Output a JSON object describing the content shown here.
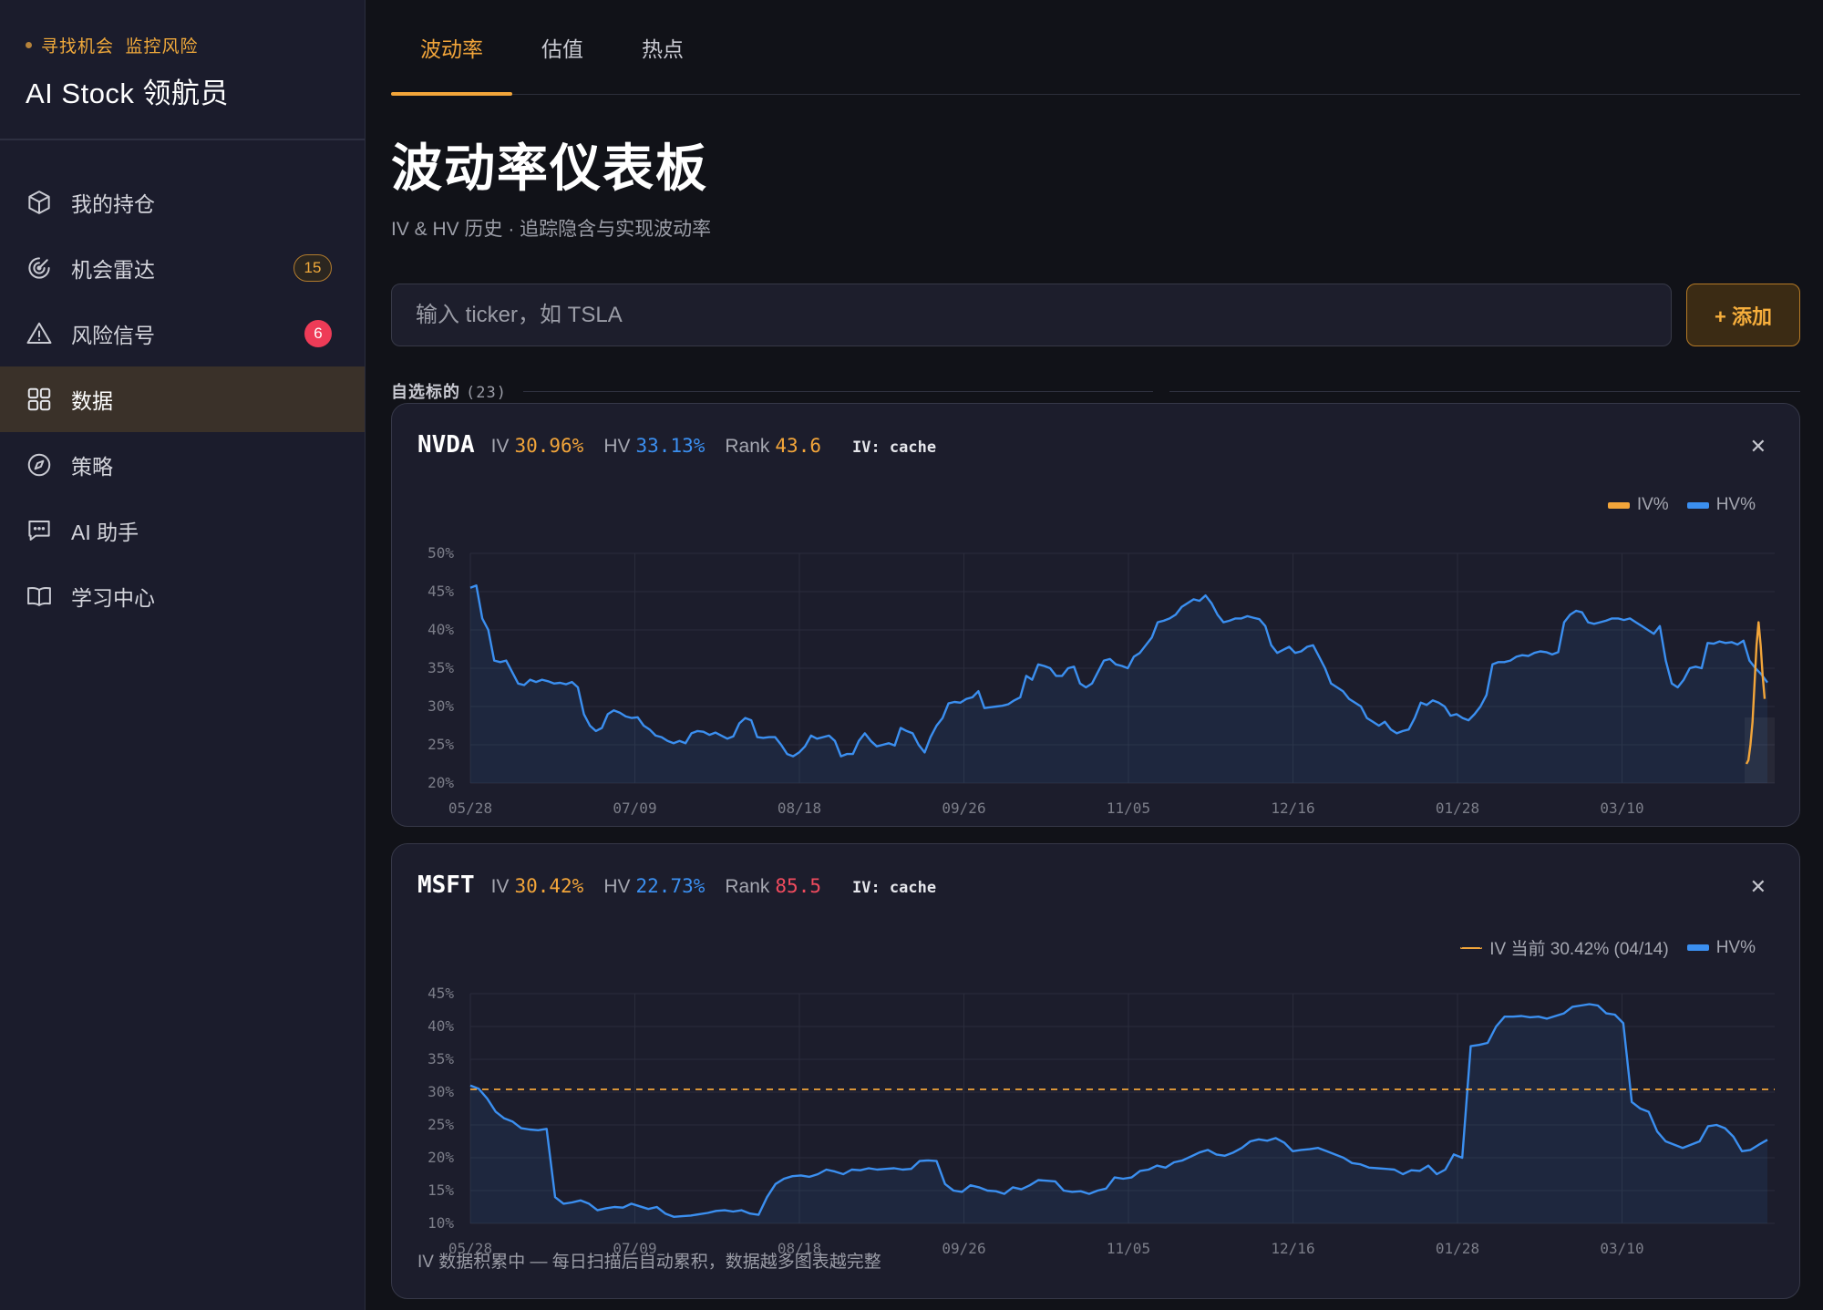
{
  "sidebar": {
    "tagline": "寻找机会  监控风险",
    "app_title": "AI Stock 领航员",
    "items": [
      {
        "label": "我的持仓",
        "icon": "cube-icon"
      },
      {
        "label": "机会雷达",
        "icon": "radar-icon",
        "badge": "15"
      },
      {
        "label": "风险信号",
        "icon": "warning-icon",
        "badge": "6"
      },
      {
        "label": "数据",
        "icon": "grid-icon"
      },
      {
        "label": "策略",
        "icon": "compass-icon"
      },
      {
        "label": "AI 助手",
        "icon": "chat-icon"
      },
      {
        "label": "学习中心",
        "icon": "book-icon"
      }
    ]
  },
  "tabs": [
    "波动率",
    "估值",
    "热点"
  ],
  "page": {
    "title": "波动率仪表板",
    "subtitle": "IV & HV 历史 · 追踪隐含与实现波动率"
  },
  "search": {
    "placeholder": "输入 ticker，如 TSLA",
    "value": ""
  },
  "add_button": "+ 添加",
  "watchlist": {
    "label": "自选标的",
    "count": "(23)"
  },
  "colors": {
    "iv": "#f2a53a",
    "hv": "#3b8ff0",
    "rank_high": "#f04b5e",
    "accent": "#f2a53a"
  },
  "cards": [
    {
      "ticker": "NVDA",
      "iv_label": "IV",
      "iv_value": "30.96%",
      "hv_label": "HV",
      "hv_value": "33.13%",
      "rank_label": "Rank",
      "rank_value": "43.6",
      "iv_source": "IV: cache",
      "legend": [
        "IV%",
        "HV%"
      ],
      "footnote": ""
    },
    {
      "ticker": "MSFT",
      "iv_label": "IV",
      "iv_value": "30.42%",
      "hv_label": "HV",
      "hv_value": "22.73%",
      "rank_label": "Rank",
      "rank_value": "85.5",
      "iv_source": "IV: cache",
      "legend": [
        "IV 当前 30.42% (04/14)",
        "HV%"
      ],
      "footnote": "IV 数据积累中 — 每日扫描后自动累积，数据越多图表越完整"
    }
  ],
  "chart_data": [
    {
      "type": "line",
      "title": "NVDA",
      "x_ticks": [
        "05/28",
        "07/09",
        "08/18",
        "09/26",
        "11/05",
        "12/16",
        "01/28",
        "03/10"
      ],
      "y_ticks": [
        "20%",
        "25%",
        "30%",
        "35%",
        "40%",
        "45%",
        "50%"
      ],
      "ylim": [
        20,
        50
      ],
      "grid": true,
      "legend_position": "top-right",
      "series": [
        {
          "name": "HV%",
          "color": "#3b8ff0",
          "values": [
            45.5,
            45.8,
            41.5,
            40,
            36,
            35.8,
            36,
            34.5,
            33,
            32.8,
            33.5,
            33.2,
            33.5,
            33.3,
            33.0,
            33.1,
            32.9,
            33.2,
            32.5,
            29,
            27.5,
            26.8,
            27.2,
            29,
            29.5,
            29.2,
            28.7,
            28.5,
            28.6,
            27.5,
            27,
            26.2,
            26,
            25.5,
            25.2,
            25.5,
            25.2,
            26.5,
            26.8,
            26.7,
            26.3,
            26.6,
            26.2,
            25.8,
            26.1,
            27.8,
            28.5,
            28.2,
            26,
            25.9,
            26,
            26,
            25,
            23.8,
            23.5,
            24,
            24.8,
            26.2,
            25.8,
            26,
            26.2,
            25.5,
            23.5,
            23.8,
            23.8,
            25.5,
            26.5,
            25.5,
            24.8,
            25,
            25.2,
            24.9,
            27.2,
            26.8,
            26.5,
            25,
            24,
            26,
            27.5,
            28.5,
            30.4,
            30.6,
            30.5,
            31,
            31.2,
            32,
            29.8,
            29.9,
            30,
            30.1,
            30.3,
            30.8,
            31.2,
            34,
            33.5,
            35.5,
            35.3,
            35,
            34,
            34,
            35,
            35.2,
            33,
            32.5,
            33,
            34.5,
            36,
            36.2,
            35.5,
            35.3,
            35,
            36.5,
            37,
            38,
            39,
            41,
            41.2,
            41.5,
            42,
            43,
            43.5,
            44,
            43.8,
            44.5,
            43.5,
            42,
            41,
            41.2,
            41.5,
            41.5,
            41.8,
            41.6,
            41.4,
            40.5,
            38,
            37,
            37.4,
            37.8,
            37,
            37.2,
            37.8,
            38,
            36.5,
            35,
            33,
            32.5,
            32,
            31,
            30.5,
            30,
            28.5,
            28,
            27.5,
            28,
            27,
            26.5,
            26.8,
            27,
            28.5,
            30.5,
            30.2,
            30.8,
            30.5,
            30,
            28.8,
            29,
            28.5,
            28.2,
            29,
            30,
            31.5,
            35.5,
            35.8,
            35.8,
            36,
            36.5,
            36.7,
            36.6,
            37,
            37.2,
            37.1,
            36.8,
            37.1,
            41,
            42,
            42.5,
            42.3,
            41,
            40.8,
            41,
            41.2,
            41.5,
            41.5,
            41.3,
            41.5,
            41,
            40.5,
            40,
            39.5,
            40.5,
            36,
            33,
            32.5,
            33.5,
            35,
            35.2,
            35,
            38.3,
            38.2,
            38.5,
            38.3,
            38.4,
            38.1,
            38.6,
            36,
            35,
            34.2,
            33.13
          ]
        },
        {
          "name": "IV%",
          "color": "#f2a53a",
          "values": [
            22.5,
            23,
            25,
            28,
            33,
            38,
            41,
            38,
            34,
            31
          ]
        }
      ]
    },
    {
      "type": "line",
      "title": "MSFT",
      "x_ticks": [
        "05/28",
        "07/09",
        "08/18",
        "09/26",
        "11/05",
        "12/16",
        "01/28",
        "03/10"
      ],
      "y_ticks": [
        "10%",
        "15%",
        "20%",
        "25%",
        "30%",
        "35%",
        "40%",
        "45%"
      ],
      "ylim": [
        10,
        45
      ],
      "grid": true,
      "legend_position": "top-right",
      "series": [
        {
          "name": "HV%",
          "color": "#3b8ff0",
          "values": [
            31,
            30.5,
            29,
            27,
            26,
            25.5,
            24.5,
            24.3,
            24.2,
            24.4,
            14,
            13,
            13.2,
            13.5,
            13,
            12,
            12.3,
            12.5,
            12.4,
            13,
            12.6,
            12.2,
            12.5,
            11.5,
            11,
            11.1,
            11.2,
            11.4,
            11.6,
            11.9,
            12.0,
            11.8,
            12,
            11.5,
            11.3,
            14,
            16,
            16.8,
            17.2,
            17.3,
            17.1,
            17.5,
            18.2,
            17.9,
            17.5,
            18.2,
            18.1,
            18.4,
            18.2,
            18.3,
            18.4,
            18.2,
            18.3,
            19.5,
            19.6,
            19.5,
            16,
            15,
            14.8,
            15.8,
            15.5,
            15,
            14.9,
            14.5,
            15.5,
            15.2,
            15.8,
            16.6,
            16.5,
            16.4,
            15,
            14.8,
            14.9,
            14.5,
            15,
            15.3,
            17,
            16.8,
            17,
            18,
            18.2,
            18.8,
            18.5,
            19.3,
            19.6,
            20.2,
            20.8,
            21.2,
            20.5,
            20.3,
            20.8,
            21.5,
            22.5,
            22.8,
            22.6,
            23,
            22.3,
            21,
            21.2,
            21.3,
            21.5,
            21.0,
            20.5,
            20,
            19.2,
            19,
            18.5,
            18.4,
            18.3,
            18.2,
            17.5,
            18.1,
            18.0,
            18.8,
            17.5,
            18.2,
            20.5,
            20,
            37,
            37.2,
            37.5,
            40,
            41.5,
            41.5,
            41.6,
            41.4,
            41.5,
            41.2,
            41.6,
            42,
            43,
            43.2,
            43.4,
            43.2,
            42,
            41.8,
            40.5,
            28.5,
            27.5,
            27,
            24,
            22.5,
            22,
            21.5,
            22,
            22.5,
            24.8,
            25,
            24.5,
            23.2,
            21,
            21.2,
            22,
            22.73
          ]
        },
        {
          "name": "IV 当前 30.42% (04/14)",
          "color": "#f2a53a",
          "dashed": true,
          "values": [
            30.42
          ]
        }
      ]
    }
  ]
}
